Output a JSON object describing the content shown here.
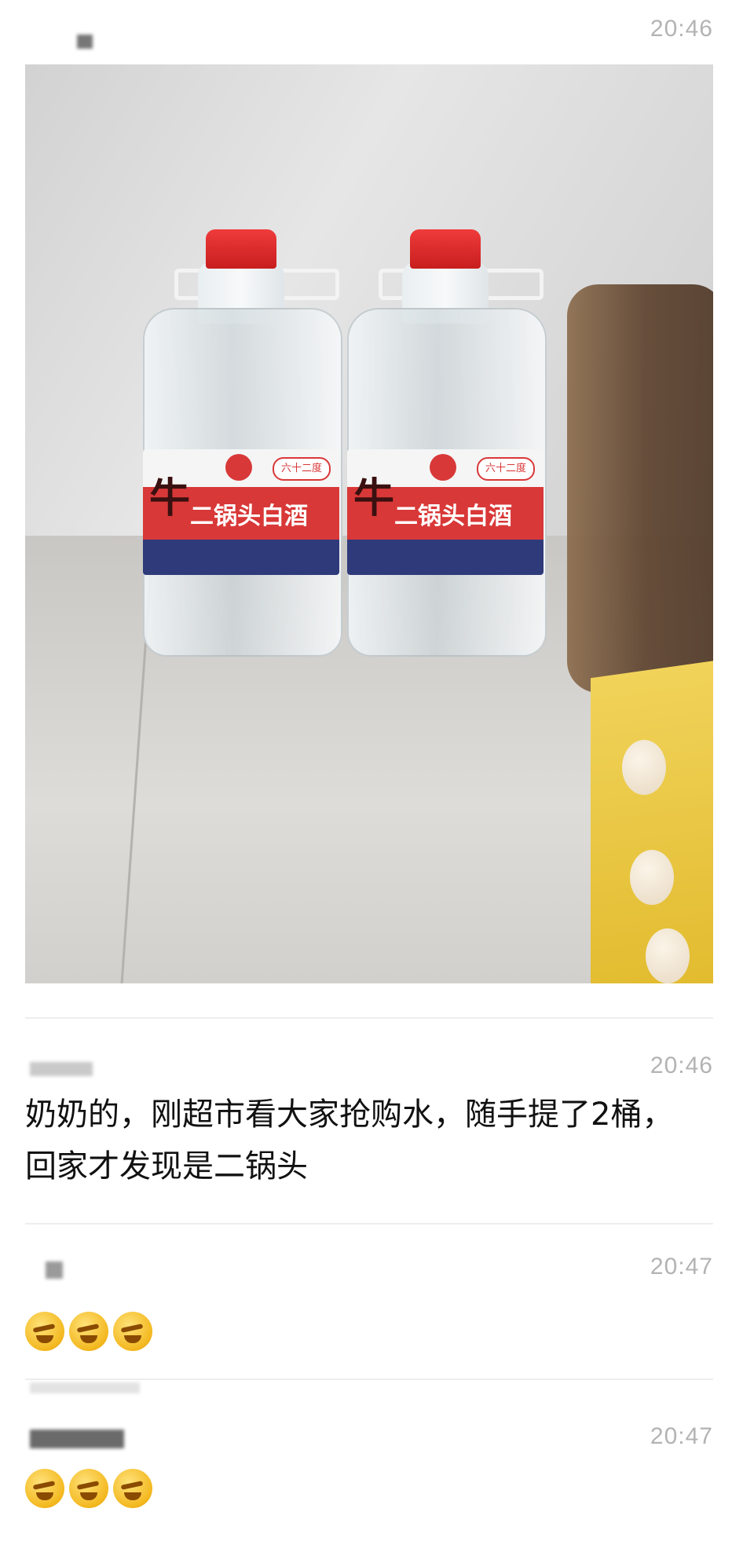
{
  "post": {
    "time": "20:46",
    "photo": {
      "bottle_label": "二锅头白酒",
      "brand_char": "牛",
      "badge": "六十二度"
    }
  },
  "comments": [
    {
      "time": "20:46",
      "text": "奶奶的，刚超市看大家抢购水，随手提了2桶，回家才发现是二锅头",
      "name_fragment": ""
    },
    {
      "time": "20:47",
      "text": "",
      "name_fragment": "n",
      "emojis": [
        "facepalm-laugh",
        "facepalm-laugh",
        "facepalm-laugh"
      ]
    },
    {
      "time": "20:47",
      "text": "",
      "name_fragment": "",
      "emojis": [
        "facepalm-laugh",
        "facepalm-laugh",
        "facepalm-laugh"
      ]
    }
  ],
  "colors": {
    "time": "#b3b3b3",
    "divider": "#eeeeee",
    "cap": "#d62828",
    "label_red": "#d93838",
    "label_blue": "#2f3a7a"
  }
}
